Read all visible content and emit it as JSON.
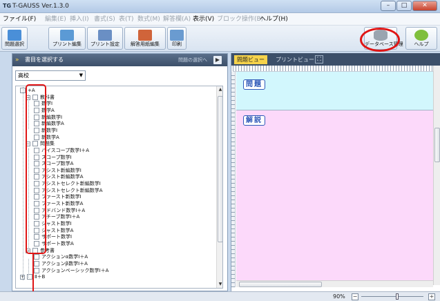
{
  "window": {
    "title": "T-GAUSS Ver.1.3.0",
    "app_icon": "TG",
    "controls": {
      "minimize": "–",
      "maximize": "□",
      "close": "✕"
    }
  },
  "menubar": {
    "items": [
      {
        "label": "ファイル(F)",
        "enabled": true
      },
      {
        "label": "編集(E)",
        "enabled": false
      },
      {
        "label": "挿入(I)",
        "enabled": false
      },
      {
        "label": "書式(S)",
        "enabled": false
      },
      {
        "label": "表(T)",
        "enabled": false
      },
      {
        "label": "数式(M)",
        "enabled": false
      },
      {
        "label": "解答欄(A)",
        "enabled": false
      },
      {
        "label": "表示(V)",
        "enabled": true
      },
      {
        "label": "ブロック操作(B)",
        "enabled": false
      },
      {
        "label": "ヘルプ(H)",
        "enabled": true
      }
    ]
  },
  "toolbar": {
    "buttons": [
      {
        "label": "問題選択",
        "icon": "question-select-icon",
        "color": "#4a8fd8"
      },
      {
        "label": "プリント編集",
        "icon": "print-edit-icon",
        "color": "#5b9ad5"
      },
      {
        "label": "プリント設定",
        "icon": "print-settings-icon",
        "color": "#6a8fc4"
      },
      {
        "label": "解答用紙編集",
        "icon": "answer-sheet-icon",
        "color": "#d0643a"
      },
      {
        "label": "印刷",
        "icon": "printer-icon",
        "color": "#6a9bd0"
      },
      {
        "label": "データベース管理",
        "icon": "database-icon",
        "color": "#9aa5b0"
      },
      {
        "label": "ヘルプ",
        "icon": "help-icon",
        "color": "#7fbf3d"
      }
    ]
  },
  "left_panel": {
    "header": "書目を選択する",
    "next_label": "問題の選択へ",
    "next_button": "▶",
    "school_dropdown": {
      "selected": "高校",
      "arrow": "▼"
    },
    "tree": [
      {
        "label": "+A",
        "level": 0,
        "expander": ""
      },
      {
        "label": "教科書",
        "level": 1,
        "expander": "−"
      },
      {
        "label": "数学Ⅰ",
        "level": 2,
        "expander": ""
      },
      {
        "label": "数学A",
        "level": 2,
        "expander": ""
      },
      {
        "label": "新編数学Ⅰ",
        "level": 2,
        "expander": ""
      },
      {
        "label": "新編数学A",
        "level": 2,
        "expander": ""
      },
      {
        "label": "新数学Ⅰ",
        "level": 2,
        "expander": ""
      },
      {
        "label": "新数学A",
        "level": 2,
        "expander": ""
      },
      {
        "label": "問題集",
        "level": 1,
        "expander": "−"
      },
      {
        "label": "ハイスコープ数学Ⅰ＋A",
        "level": 2,
        "expander": ""
      },
      {
        "label": "スコープ数学Ⅰ",
        "level": 2,
        "expander": ""
      },
      {
        "label": "スコープ数学A",
        "level": 2,
        "expander": ""
      },
      {
        "label": "アシスト新編数学Ⅰ",
        "level": 2,
        "expander": ""
      },
      {
        "label": "アシスト新編数学A",
        "level": 2,
        "expander": ""
      },
      {
        "label": "アシストセレクト新編数学Ⅰ",
        "level": 2,
        "expander": ""
      },
      {
        "label": "アシストセレクト新編数学A",
        "level": 2,
        "expander": ""
      },
      {
        "label": "ファースト新数学Ⅰ",
        "level": 2,
        "expander": ""
      },
      {
        "label": "ファースト新数学A",
        "level": 2,
        "expander": ""
      },
      {
        "label": "アドバンド数学Ⅰ＋A",
        "level": 2,
        "expander": ""
      },
      {
        "label": "アチーブ数学Ⅰ＋A",
        "level": 2,
        "expander": ""
      },
      {
        "label": "ジャスト数学Ⅰ",
        "level": 2,
        "expander": ""
      },
      {
        "label": "ジャスト数学A",
        "level": 2,
        "expander": ""
      },
      {
        "label": "サポート数学Ⅰ",
        "level": 2,
        "expander": ""
      },
      {
        "label": "サポート数学A",
        "level": 2,
        "expander": ""
      },
      {
        "label": "参考書",
        "level": 1,
        "expander": "−"
      },
      {
        "label": "アクションα数学Ⅰ＋A",
        "level": 2,
        "expander": ""
      },
      {
        "label": "アクションβ数学Ⅰ＋A",
        "level": 2,
        "expander": ""
      },
      {
        "label": "アクションベーシック数学Ⅰ＋A",
        "level": 2,
        "expander": ""
      },
      {
        "label": "Ⅱ＋B",
        "level": 0,
        "expander": "+"
      }
    ],
    "scroll_up": "▲",
    "scroll_down": "▼"
  },
  "right_panel": {
    "tabs": [
      {
        "label": "問題ビュー",
        "active": true
      },
      {
        "label": "プリントビュー",
        "active": false
      }
    ],
    "expand_icon": "⛶",
    "question_label": "問題",
    "answer_label": "解説",
    "question_bg": "#d2f7fd",
    "answer_bg": "#fcd9fa"
  },
  "status": {
    "zoom": "90%",
    "zoom_fraction": 0.58,
    "zoom_minus": "−",
    "zoom_plus": "+"
  },
  "annotations": {
    "ring_color": "#e01515"
  }
}
